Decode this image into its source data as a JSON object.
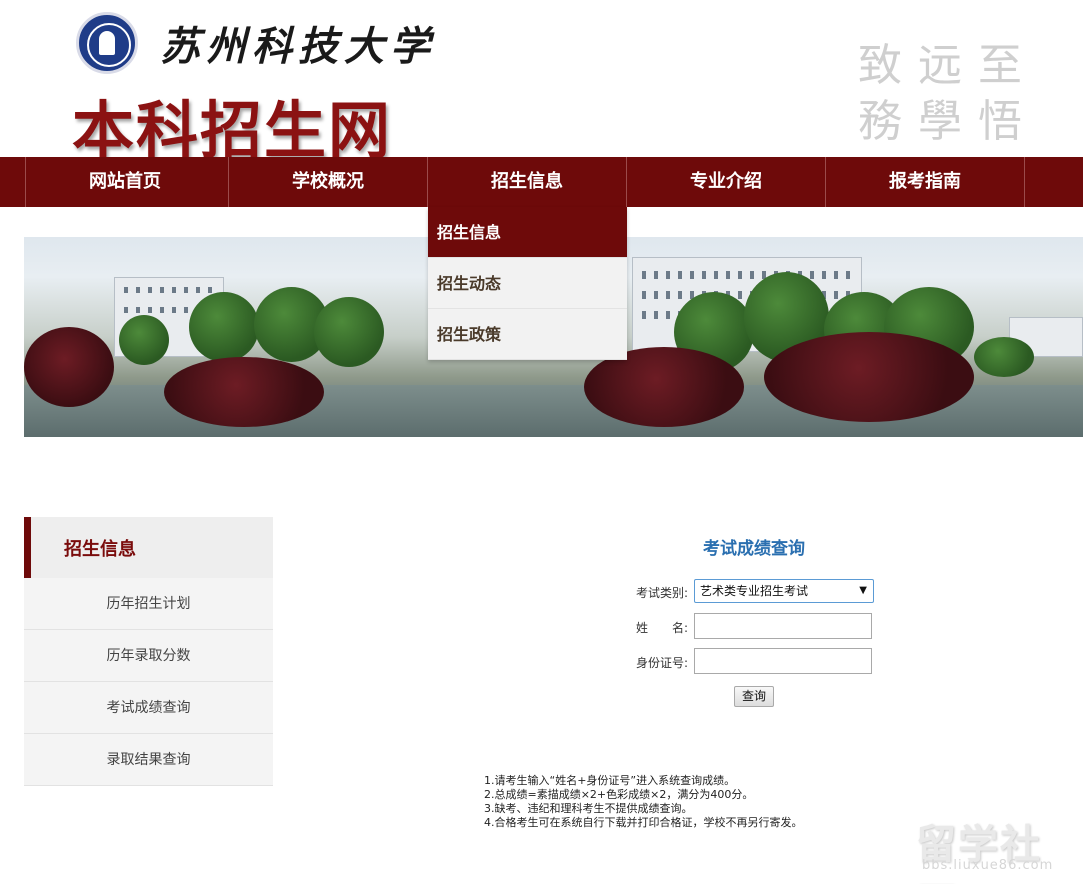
{
  "header": {
    "calligraphy_title": "苏州科技大学",
    "site_title": "本科招生网",
    "motto_lines": [
      "致远至",
      "務學悟"
    ]
  },
  "nav": {
    "items": [
      {
        "label": "网站首页"
      },
      {
        "label": "学校概况"
      },
      {
        "label": "招生信息"
      },
      {
        "label": "专业介绍"
      },
      {
        "label": "报考指南"
      }
    ]
  },
  "dropdown": {
    "items": [
      {
        "label": "招生信息",
        "active": true
      },
      {
        "label": "招生动态"
      },
      {
        "label": "招生政策"
      }
    ]
  },
  "sidebar": {
    "title": "招生信息",
    "items": [
      {
        "label": "历年招生计划"
      },
      {
        "label": "历年录取分数"
      },
      {
        "label": "考试成绩查询"
      },
      {
        "label": "录取结果查询"
      }
    ]
  },
  "query": {
    "title": "考试成绩查询",
    "category_label": "考试类别:",
    "category_value": "艺术类专业招生考试",
    "name_label": "姓　　名:",
    "id_label": "身份证号:",
    "button_label": "查询"
  },
  "notes": [
    "1.请考生输入“姓名+身份证号”进入系统查询成绩。",
    "2.总成绩=素描成绩×2+色彩成绩×2，满分为400分。",
    "3.缺考、违纪和理科考生不提供成绩查询。",
    "4.合格考生可在系统自行下载并打印合格证，学校不再另行寄发。"
  ],
  "watermark": {
    "big": "留学社区",
    "small": "bbs.liuxue86.com"
  },
  "colors": {
    "brand": "#6e0a0a",
    "title_blue": "#2a6fb0"
  }
}
